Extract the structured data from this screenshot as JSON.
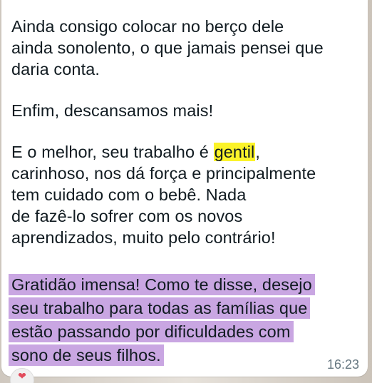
{
  "message": {
    "paragraph1": [
      "Ainda consigo colocar no berço dele",
      "ainda sonolento, o que jamais pensei que",
      "daria conta."
    ],
    "paragraph2": "Enfim, descansamos mais!",
    "paragraph3": {
      "line1_before": "E o melhor, seu trabalho é ",
      "line1_highlight": "gentil",
      "line1_after": ",",
      "lines": [
        "carinhoso, nos dá força e principalmente",
        "tem cuidado com o bebê. Nada",
        "de fazê-lo sofrer com os novos",
        "aprendizados, muito pelo contrário!"
      ]
    },
    "paragraph4_highlighted": [
      "Gratidão imensa! Como te disse, desejo",
      "seu trabalho para todas as famílias que",
      "estão passando por dificuldades com",
      "sono de seus filhos."
    ],
    "timestamp": "16:23",
    "reaction_icon": "heart-icon"
  },
  "colors": {
    "highlight_yellow": "#fbf32a",
    "highlight_purple": "#c9a6e2",
    "bubble": "#ffffff",
    "text": "#111b21",
    "timestamp": "#667781"
  }
}
